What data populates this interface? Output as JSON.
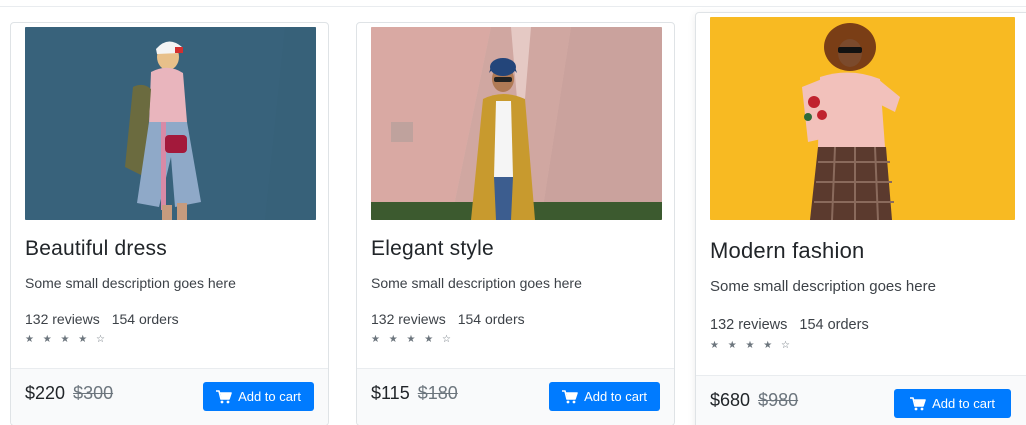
{
  "colors": {
    "accent": "#007bff",
    "text": "#212529",
    "muted": "#6c757d",
    "card_border": "#dfe3e6"
  },
  "products": [
    {
      "title": "Beautiful dress",
      "description": "Some small description goes here",
      "reviews": "132 reviews",
      "orders": "154 orders",
      "rating": 4,
      "stars": "★ ★ ★ ★ ☆",
      "price": "$220",
      "old_price": "$300",
      "button_label": "Add to cart",
      "button_icon": "cart-icon"
    },
    {
      "title": "Elegant style",
      "description": "Some small description goes here",
      "reviews": "132 reviews",
      "orders": "154 orders",
      "rating": 4,
      "stars": "★ ★ ★ ★ ☆",
      "price": "$115",
      "old_price": "$180",
      "button_label": "Add to cart",
      "button_icon": "cart-icon"
    },
    {
      "title": "Modern fashion",
      "description": "Some small description goes here",
      "reviews": "132 reviews",
      "orders": "154 orders",
      "rating": 4,
      "stars": "★ ★ ★ ★ ☆",
      "price": "$680",
      "old_price": "$980",
      "button_label": "Add to cart",
      "button_icon": "cart-icon"
    }
  ]
}
